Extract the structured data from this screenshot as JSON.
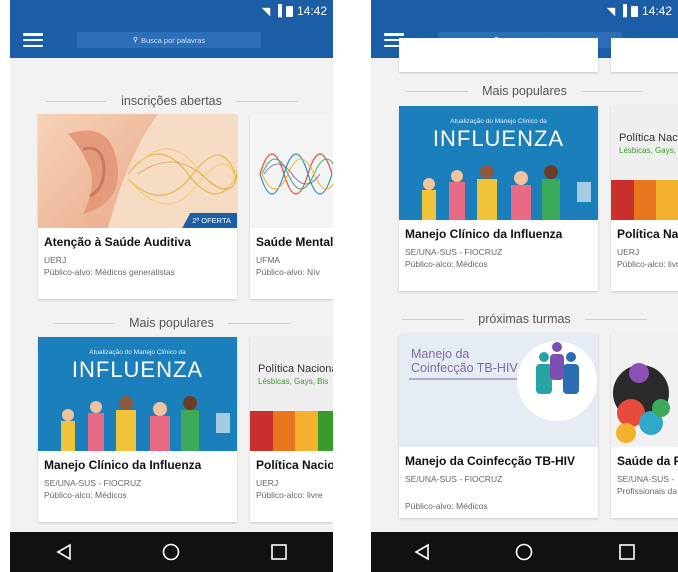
{
  "status": {
    "time": "14:42"
  },
  "search": {
    "placeholder": "Busca por palavras"
  },
  "sections": {
    "open": "inscrições abertas",
    "popular": "Mais populares",
    "next": "próximas turmas"
  },
  "cards": {
    "auditiva": {
      "title": "Atenção à Saúde Auditiva",
      "inst": "UERJ",
      "aud": "Público-alvo: Médicos generalistas",
      "badge": "2ª OFERTA"
    },
    "mental": {
      "title": "Saúde Mental",
      "inst": "UFMA",
      "aud": "Público-alvo: Nív"
    },
    "influenza": {
      "title": "Manejo Clínico da Influenza",
      "inst": "SE/UNA-SUS - FIOCRUZ",
      "aud": "Público-alco: Médicos",
      "thumb_small": "Atualização do Manejo Clínico da",
      "thumb_big": "INFLUENZA"
    },
    "politica": {
      "title": "Política Nacional",
      "inst": "UERJ",
      "aud": "Público-alco: livre",
      "thumb_line1": "Política Nacional",
      "thumb_line2": "Lésbicas, Gays, Bis"
    },
    "tbhiv": {
      "title": "Manejo da Coinfecção TB-HIV",
      "inst": "SE/UNA-SUS - FIOCRUZ",
      "aud": "Público-alvo: Médicos",
      "thumb_line1": "Manejo da",
      "thumb_line2": "Coinfecção TB-HIV"
    },
    "saudepo": {
      "title": "Saúde da Po",
      "inst": "SE/UNA-SUS -",
      "aud": "Profissionais da"
    }
  },
  "colors": {
    "primary": "#1c5ea6",
    "accent_green": "#3b9a2c"
  }
}
